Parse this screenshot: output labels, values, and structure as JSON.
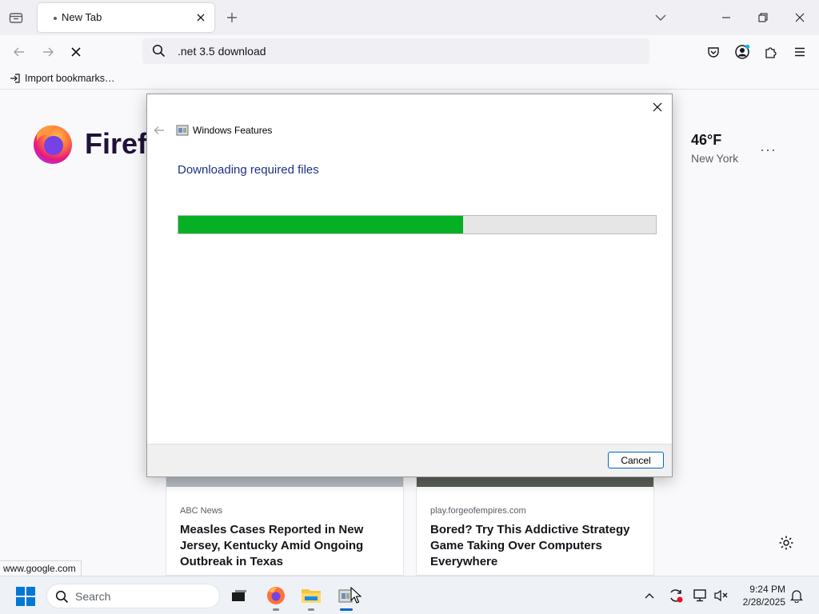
{
  "browser": {
    "tab_title": "New Tab",
    "url_value": ".net 3.5 download",
    "import_bookmarks": "Import bookmarks…",
    "status_url": "www.google.com"
  },
  "newtab": {
    "brand": "Firefox",
    "weather_temp": "46°F",
    "weather_city": "New York",
    "weather_more": "···",
    "cards": [
      {
        "source": "ABC News",
        "headline": "Measles Cases Reported in New Jersey, Kentucky Amid Ongoing Outbreak in Texas"
      },
      {
        "source": "play.forgeofempires.com",
        "headline": "Bored? Try This Addictive Strategy Game Taking Over Computers Everywhere"
      }
    ]
  },
  "dialog": {
    "window_title": "Windows Features",
    "heading": "Downloading required files",
    "progress_fraction": 0.597,
    "cancel_label": "Cancel"
  },
  "taskbar": {
    "search_label": "Search",
    "time": "9:24 PM",
    "date": "2/28/2025"
  },
  "colors": {
    "progress_fill": "#06b025",
    "dialog_heading": "#1e3287",
    "windows_accent": "#0078d4"
  },
  "icons": [
    "list-all-tabs-icon",
    "close-icon",
    "plus-icon",
    "chevron-down-icon",
    "minimize-icon",
    "restore-icon",
    "back-arrow-icon",
    "forward-arrow-icon",
    "stop-icon",
    "search-icon",
    "pocket-icon",
    "account-icon",
    "extensions-icon",
    "hamburger-menu-icon",
    "import-icon",
    "firefox-logo-icon",
    "gear-icon",
    "windows-start-icon",
    "task-view-icon",
    "firefox-taskbar-icon",
    "file-explorer-icon",
    "windows-features-icon",
    "chevron-up-icon",
    "sync-icon",
    "network-icon",
    "volume-muted-icon",
    "bell-icon",
    "mouse-cursor-icon"
  ]
}
